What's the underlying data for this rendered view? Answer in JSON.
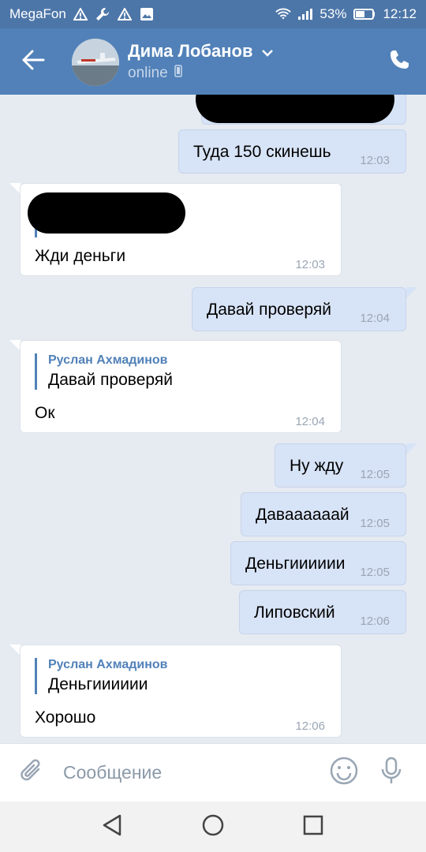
{
  "status_bar": {
    "carrier": "MegaFon",
    "battery": "53%",
    "time": "12:12"
  },
  "header": {
    "name": "Дима Лобанов",
    "status": "online",
    "colors": {
      "bar": "#5181b8",
      "status_bar": "#4d76a8"
    }
  },
  "messages": [
    {
      "dir": "out",
      "text": "Туда 150 скинешь",
      "time": "12:03"
    },
    {
      "dir": "in",
      "text": "Жди деньги",
      "time": "12:03",
      "redacted_reply": true
    },
    {
      "dir": "out",
      "text": "Давай проверяй",
      "time": "12:04"
    },
    {
      "dir": "in",
      "reply_author": "Руслан Ахмадинов",
      "reply_text": "Давай проверяй",
      "text": "Ок",
      "time": "12:04"
    },
    {
      "dir": "out",
      "text": "Ну жду",
      "time": "12:05"
    },
    {
      "dir": "out",
      "text": "Даваааааай",
      "time": "12:05"
    },
    {
      "dir": "out",
      "text": "Деньгииииии",
      "time": "12:05"
    },
    {
      "dir": "out",
      "text": "Липовский",
      "time": "12:06"
    },
    {
      "dir": "in",
      "reply_author": "Руслан Ахмадинов",
      "reply_text": "Деньгииииии",
      "text": "Хорошо",
      "time": "12:06"
    }
  ],
  "input": {
    "placeholder": "Сообщение"
  },
  "icons": {
    "back": "arrow-left-icon",
    "phone": "phone-icon",
    "attach": "paperclip-icon",
    "emoji": "smiley-icon",
    "mic": "microphone-icon",
    "nav_back": "triangle-back-icon",
    "nav_home": "circle-home-icon",
    "nav_recent": "square-recent-icon"
  }
}
